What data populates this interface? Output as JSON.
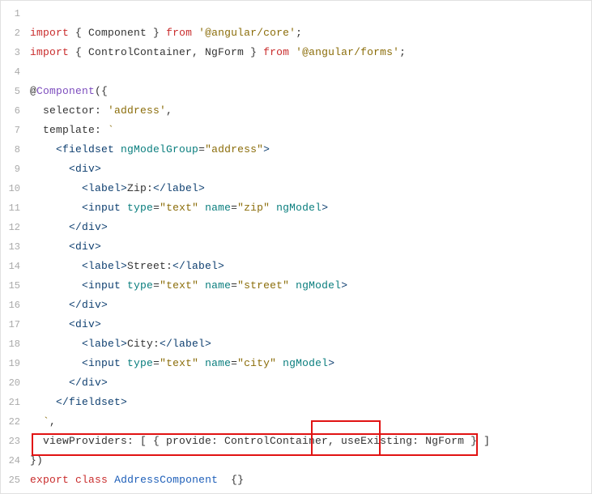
{
  "lines": [
    {
      "num": "1",
      "tokens": []
    },
    {
      "num": "2",
      "tokens": [
        {
          "t": "import",
          "c": "kw-red"
        },
        {
          "t": " { ",
          "c": "default"
        },
        {
          "t": "Component",
          "c": "default"
        },
        {
          "t": " } ",
          "c": "default"
        },
        {
          "t": "from",
          "c": "kw-red"
        },
        {
          "t": " ",
          "c": "default"
        },
        {
          "t": "'@angular/core'",
          "c": "str-brown"
        },
        {
          "t": ";",
          "c": "default"
        }
      ]
    },
    {
      "num": "3",
      "tokens": [
        {
          "t": "import",
          "c": "kw-red"
        },
        {
          "t": " { ",
          "c": "default"
        },
        {
          "t": "ControlContainer, NgForm",
          "c": "default"
        },
        {
          "t": " } ",
          "c": "default"
        },
        {
          "t": "from",
          "c": "kw-red"
        },
        {
          "t": " ",
          "c": "default"
        },
        {
          "t": "'@angular/forms'",
          "c": "str-brown"
        },
        {
          "t": ";",
          "c": "default"
        }
      ]
    },
    {
      "num": "4",
      "tokens": []
    },
    {
      "num": "5",
      "tokens": [
        {
          "t": "@",
          "c": "default"
        },
        {
          "t": "Component",
          "c": "kw-purple"
        },
        {
          "t": "({",
          "c": "default"
        }
      ]
    },
    {
      "num": "6",
      "tokens": [
        {
          "t": "  selector: ",
          "c": "default"
        },
        {
          "t": "'address'",
          "c": "str-brown"
        },
        {
          "t": ",",
          "c": "default"
        }
      ]
    },
    {
      "num": "7",
      "tokens": [
        {
          "t": "  template: ",
          "c": "default"
        },
        {
          "t": "`",
          "c": "str-brown"
        }
      ]
    },
    {
      "num": "8",
      "tokens": [
        {
          "t": "    ",
          "c": "default"
        },
        {
          "t": "<fieldset",
          "c": "attr-darkblue"
        },
        {
          "t": " ",
          "c": "default"
        },
        {
          "t": "ngModelGroup",
          "c": "attr-teal"
        },
        {
          "t": "=",
          "c": "default"
        },
        {
          "t": "\"address\"",
          "c": "str-brown"
        },
        {
          "t": ">",
          "c": "attr-darkblue"
        }
      ]
    },
    {
      "num": "9",
      "tokens": [
        {
          "t": "      ",
          "c": "default"
        },
        {
          "t": "<div>",
          "c": "attr-darkblue"
        }
      ]
    },
    {
      "num": "10",
      "tokens": [
        {
          "t": "        ",
          "c": "default"
        },
        {
          "t": "<label>",
          "c": "attr-darkblue"
        },
        {
          "t": "Zip:",
          "c": "default"
        },
        {
          "t": "</label>",
          "c": "attr-darkblue"
        }
      ]
    },
    {
      "num": "11",
      "tokens": [
        {
          "t": "        ",
          "c": "default"
        },
        {
          "t": "<input",
          "c": "attr-darkblue"
        },
        {
          "t": " ",
          "c": "default"
        },
        {
          "t": "type",
          "c": "attr-teal"
        },
        {
          "t": "=",
          "c": "default"
        },
        {
          "t": "\"text\"",
          "c": "str-brown"
        },
        {
          "t": " ",
          "c": "default"
        },
        {
          "t": "name",
          "c": "attr-teal"
        },
        {
          "t": "=",
          "c": "default"
        },
        {
          "t": "\"zip\"",
          "c": "str-brown"
        },
        {
          "t": " ",
          "c": "default"
        },
        {
          "t": "ngModel",
          "c": "attr-teal"
        },
        {
          "t": ">",
          "c": "attr-darkblue"
        }
      ]
    },
    {
      "num": "12",
      "tokens": [
        {
          "t": "      ",
          "c": "default"
        },
        {
          "t": "</div>",
          "c": "attr-darkblue"
        }
      ]
    },
    {
      "num": "13",
      "tokens": [
        {
          "t": "      ",
          "c": "default"
        },
        {
          "t": "<div>",
          "c": "attr-darkblue"
        }
      ]
    },
    {
      "num": "14",
      "tokens": [
        {
          "t": "        ",
          "c": "default"
        },
        {
          "t": "<label>",
          "c": "attr-darkblue"
        },
        {
          "t": "Street:",
          "c": "default"
        },
        {
          "t": "</label>",
          "c": "attr-darkblue"
        }
      ]
    },
    {
      "num": "15",
      "tokens": [
        {
          "t": "        ",
          "c": "default"
        },
        {
          "t": "<input",
          "c": "attr-darkblue"
        },
        {
          "t": " ",
          "c": "default"
        },
        {
          "t": "type",
          "c": "attr-teal"
        },
        {
          "t": "=",
          "c": "default"
        },
        {
          "t": "\"text\"",
          "c": "str-brown"
        },
        {
          "t": " ",
          "c": "default"
        },
        {
          "t": "name",
          "c": "attr-teal"
        },
        {
          "t": "=",
          "c": "default"
        },
        {
          "t": "\"street\"",
          "c": "str-brown"
        },
        {
          "t": " ",
          "c": "default"
        },
        {
          "t": "ngModel",
          "c": "attr-teal"
        },
        {
          "t": ">",
          "c": "attr-darkblue"
        }
      ]
    },
    {
      "num": "16",
      "tokens": [
        {
          "t": "      ",
          "c": "default"
        },
        {
          "t": "</div>",
          "c": "attr-darkblue"
        }
      ]
    },
    {
      "num": "17",
      "tokens": [
        {
          "t": "      ",
          "c": "default"
        },
        {
          "t": "<div>",
          "c": "attr-darkblue"
        }
      ]
    },
    {
      "num": "18",
      "tokens": [
        {
          "t": "        ",
          "c": "default"
        },
        {
          "t": "<label>",
          "c": "attr-darkblue"
        },
        {
          "t": "City:",
          "c": "default"
        },
        {
          "t": "</label>",
          "c": "attr-darkblue"
        }
      ]
    },
    {
      "num": "19",
      "tokens": [
        {
          "t": "        ",
          "c": "default"
        },
        {
          "t": "<input",
          "c": "attr-darkblue"
        },
        {
          "t": " ",
          "c": "default"
        },
        {
          "t": "type",
          "c": "attr-teal"
        },
        {
          "t": "=",
          "c": "default"
        },
        {
          "t": "\"text\"",
          "c": "str-brown"
        },
        {
          "t": " ",
          "c": "default"
        },
        {
          "t": "name",
          "c": "attr-teal"
        },
        {
          "t": "=",
          "c": "default"
        },
        {
          "t": "\"city\"",
          "c": "str-brown"
        },
        {
          "t": " ",
          "c": "default"
        },
        {
          "t": "ngModel",
          "c": "attr-teal"
        },
        {
          "t": ">",
          "c": "attr-darkblue"
        }
      ]
    },
    {
      "num": "20",
      "tokens": [
        {
          "t": "      ",
          "c": "default"
        },
        {
          "t": "</div>",
          "c": "attr-darkblue"
        }
      ]
    },
    {
      "num": "21",
      "tokens": [
        {
          "t": "    ",
          "c": "default"
        },
        {
          "t": "</fieldset>",
          "c": "attr-darkblue"
        }
      ]
    },
    {
      "num": "22",
      "tokens": [
        {
          "t": "  ",
          "c": "default"
        },
        {
          "t": "`",
          "c": "str-brown"
        },
        {
          "t": ",",
          "c": "default"
        }
      ]
    },
    {
      "num": "23",
      "tokens": [
        {
          "t": "  viewProviders: [ { provide: ControlContainer, useExisting: NgForm } ]",
          "c": "default"
        }
      ]
    },
    {
      "num": "24",
      "tokens": [
        {
          "t": "})",
          "c": "default"
        }
      ]
    },
    {
      "num": "25",
      "tokens": [
        {
          "t": "export",
          "c": "kw-red"
        },
        {
          "t": " ",
          "c": "default"
        },
        {
          "t": "class",
          "c": "kw-red"
        },
        {
          "t": " ",
          "c": "default"
        },
        {
          "t": "AddressComponent",
          "c": "kw-blue-class"
        },
        {
          "t": "  {}",
          "c": "default"
        }
      ]
    }
  ],
  "highlights": {
    "box1": {
      "description": "viewProviders line highlight"
    },
    "box2": {
      "description": "useExisting keyword highlight"
    }
  }
}
